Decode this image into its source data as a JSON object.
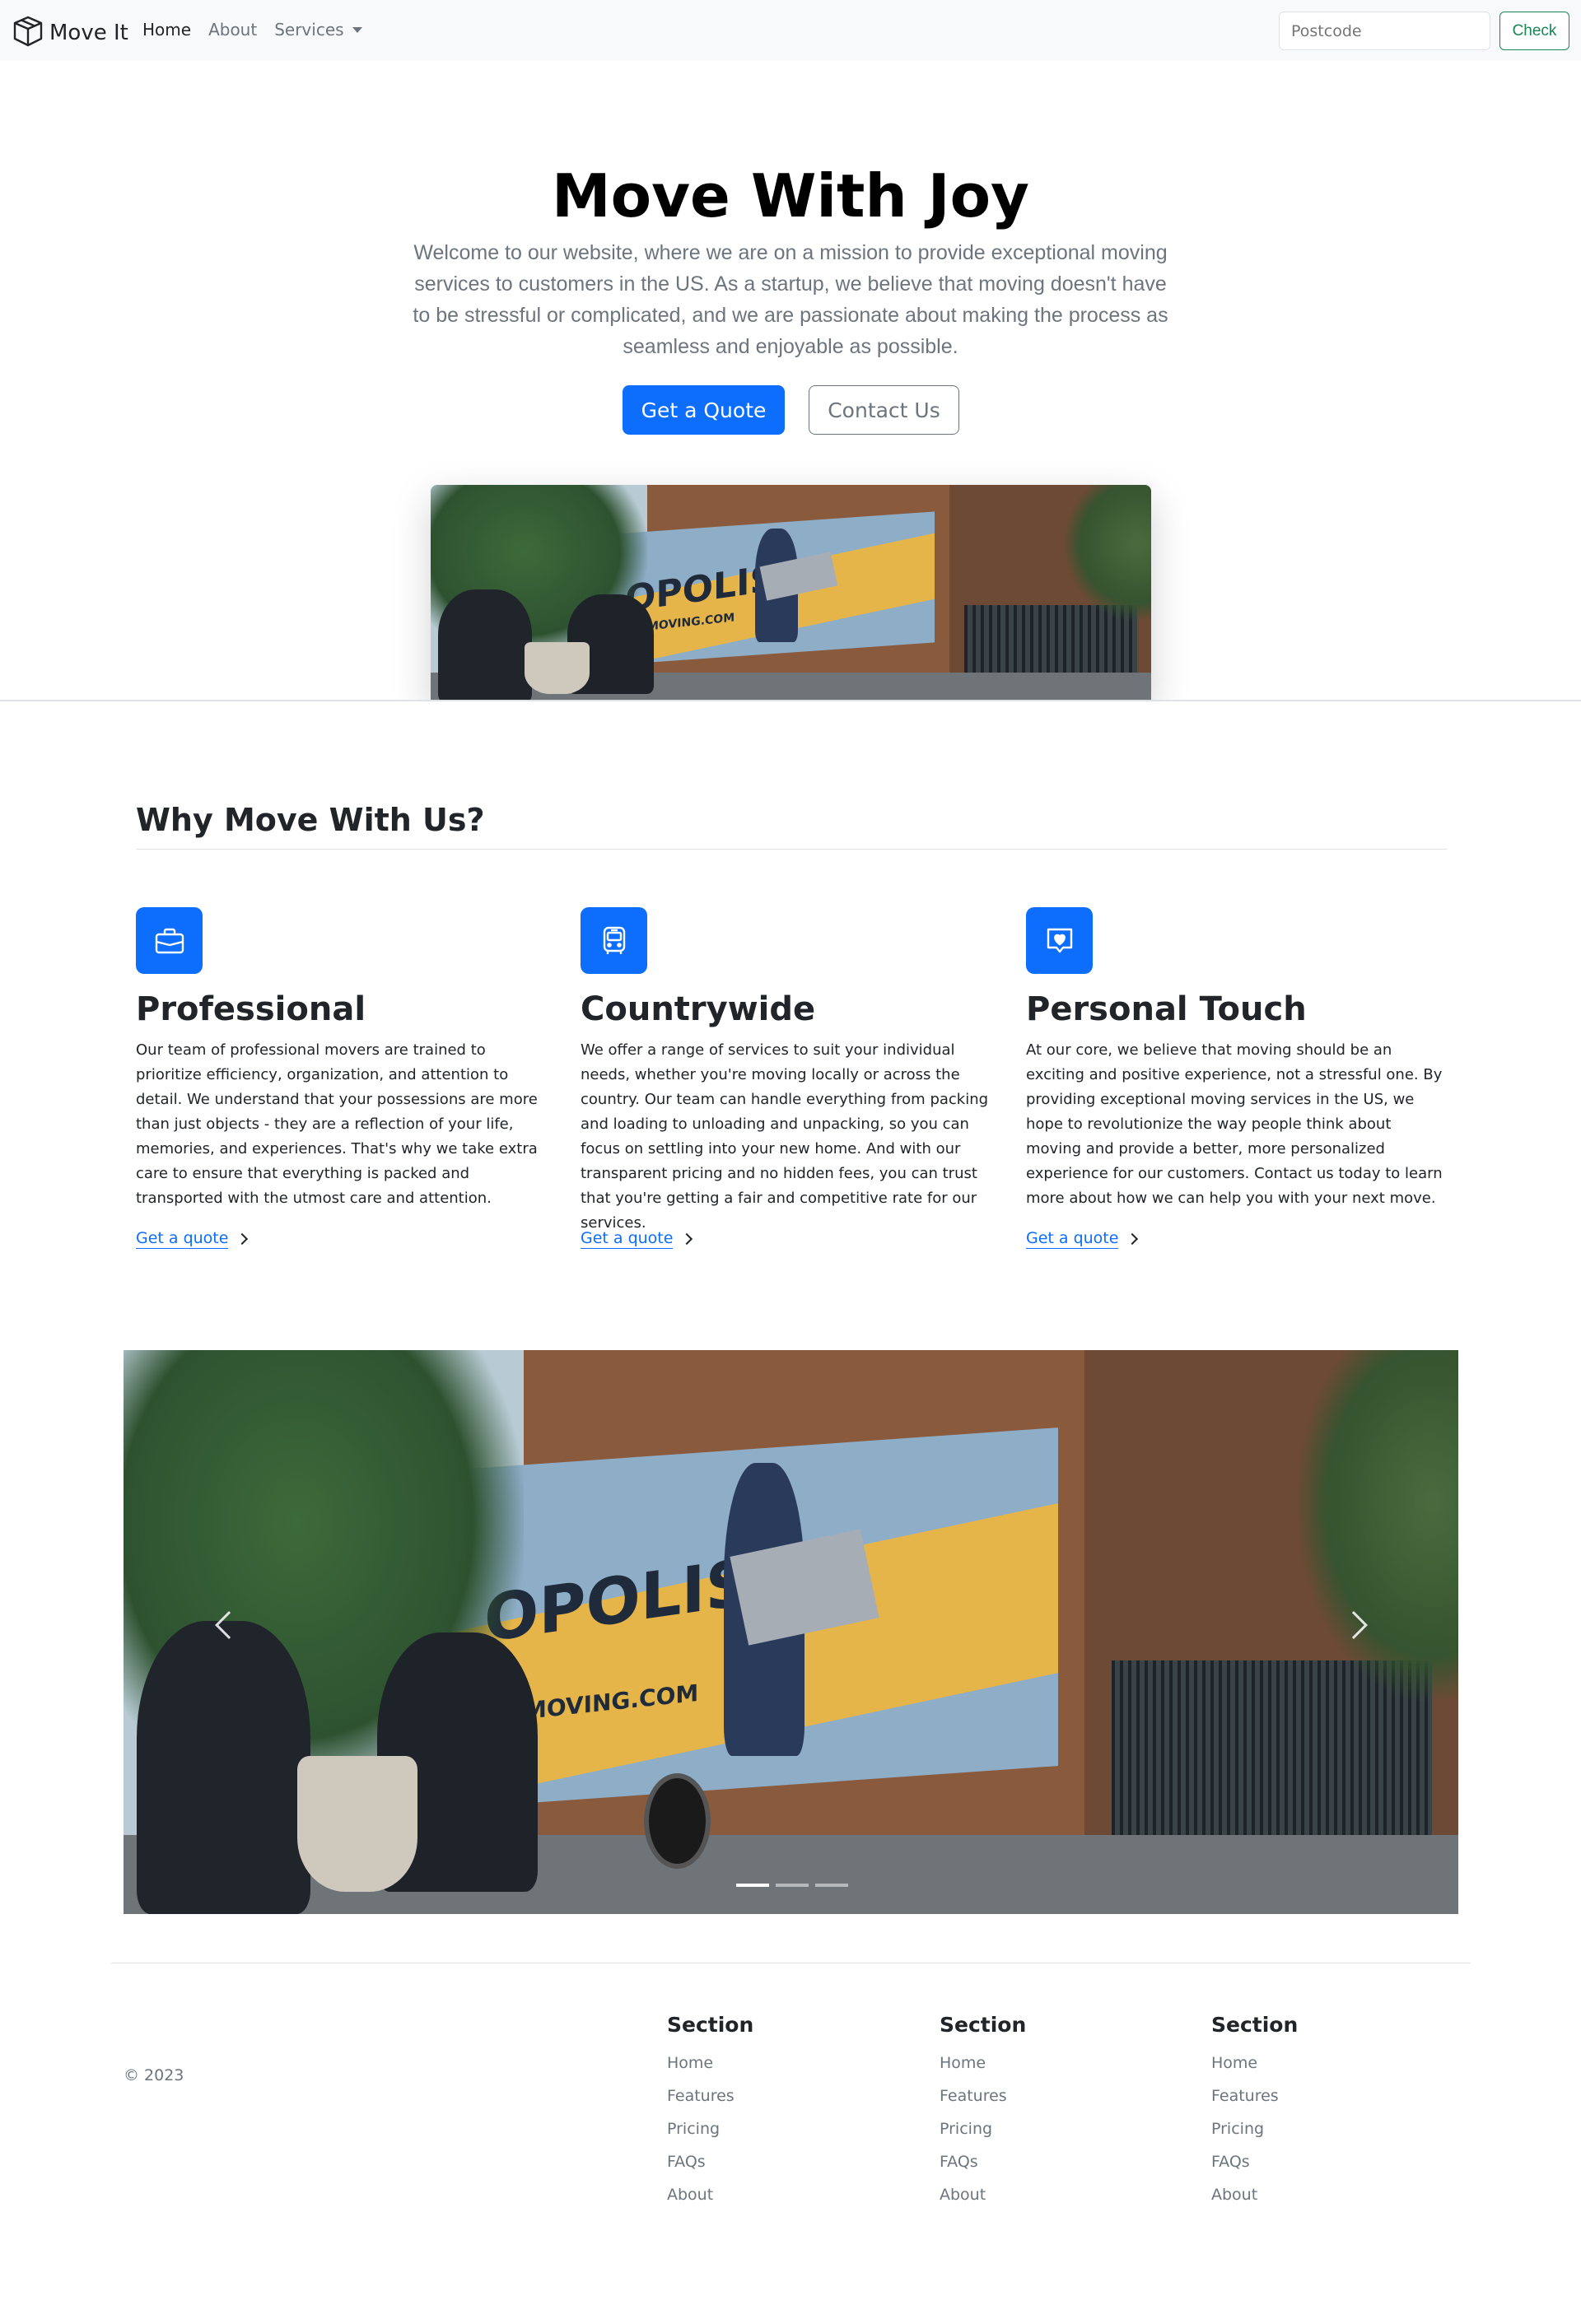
{
  "navbar": {
    "brand": "Move It",
    "links": [
      {
        "label": "Home"
      },
      {
        "label": "About"
      },
      {
        "label": "Services"
      }
    ],
    "postcode_placeholder": "Postcode",
    "check_label": "Check"
  },
  "hero": {
    "title": "Move With Joy",
    "lead": "Welcome to our website, where we are on a mission to provide exceptional moving services to customers in the US. As a startup, we believe that moving doesn't have to be stressful or complicated, and we are passionate about making the process as seamless and enjoyable as possible.",
    "primary_button": "Get a Quote",
    "secondary_button": "Contact Us",
    "photo_text": {
      "logo": "OPOLIS",
      "site": "MOVING.COM"
    }
  },
  "features": {
    "title": "Why Move With Us?",
    "items": [
      {
        "icon": "briefcase-icon",
        "title": "Professional",
        "text": "Our team of professional movers are trained to prioritize efficiency, organization, and attention to detail. We understand that your possessions are more than just objects - they are a reflection of your life, memories, and experiences. That's why we take extra care to ensure that everything is packed and transported with the utmost care and attention.",
        "link": "Get a quote"
      },
      {
        "icon": "bus-icon",
        "title": "Countrywide",
        "text": "We offer a range of services to suit your individual needs, whether you're moving locally or across the country. Our team can handle everything from packing and loading to unloading and unpacking, so you can focus on settling into your new home. And with our transparent pricing and no hidden fees, you can trust that you're getting a fair and competitive rate for our services.",
        "link": "Get a quote"
      },
      {
        "icon": "chat-heart-icon",
        "title": "Personal Touch",
        "text": "At our core, we believe that moving should be an exciting and positive experience, not a stressful one. By providing exceptional moving services in the US, we hope to revolutionize the way people think about moving and provide a better, more personalized experience for our customers. Contact us today to learn more about how we can help you with your next move.",
        "link": "Get a quote"
      }
    ]
  },
  "carousel": {
    "photo_text": {
      "logo": "OPOLIS",
      "site": "MOVING.COM"
    },
    "slide_count": 3,
    "active_slide": 1
  },
  "footer": {
    "copyright": "© 2023",
    "columns": [
      {
        "title": "Section",
        "links": [
          "Home",
          "Features",
          "Pricing",
          "FAQs",
          "About"
        ]
      },
      {
        "title": "Section",
        "links": [
          "Home",
          "Features",
          "Pricing",
          "FAQs",
          "About"
        ]
      },
      {
        "title": "Section",
        "links": [
          "Home",
          "Features",
          "Pricing",
          "FAQs",
          "About"
        ]
      }
    ]
  },
  "colors": {
    "primary": "#0d6efd",
    "success": "#198754",
    "muted": "#6c757d",
    "navbar_bg": "#f8f9fa"
  }
}
